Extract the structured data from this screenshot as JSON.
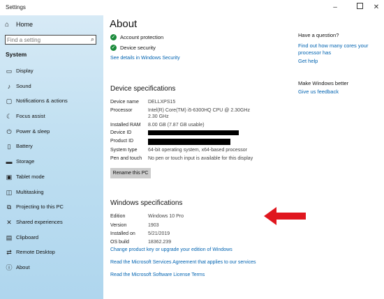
{
  "window": {
    "title": "Settings"
  },
  "sidebar": {
    "home_label": "Home",
    "search_placeholder": "Find a setting",
    "section_label": "System",
    "items": [
      {
        "label": "Display",
        "icon": "display-icon"
      },
      {
        "label": "Sound",
        "icon": "sound-icon"
      },
      {
        "label": "Notifications & actions",
        "icon": "notifications-icon"
      },
      {
        "label": "Focus assist",
        "icon": "focus-assist-icon"
      },
      {
        "label": "Power & sleep",
        "icon": "power-icon"
      },
      {
        "label": "Battery",
        "icon": "battery-icon"
      },
      {
        "label": "Storage",
        "icon": "storage-icon"
      },
      {
        "label": "Tablet mode",
        "icon": "tablet-icon"
      },
      {
        "label": "Multitasking",
        "icon": "multitasking-icon"
      },
      {
        "label": "Projecting to this PC",
        "icon": "projecting-icon"
      },
      {
        "label": "Shared experiences",
        "icon": "shared-icon"
      },
      {
        "label": "Clipboard",
        "icon": "clipboard-icon"
      },
      {
        "label": "Remote Desktop",
        "icon": "remote-desktop-icon"
      },
      {
        "label": "About",
        "icon": "info-icon"
      }
    ]
  },
  "main": {
    "title": "About",
    "security": {
      "items": [
        "Account protection",
        "Device security"
      ],
      "link": "See details in Windows Security"
    },
    "device_specs": {
      "heading": "Device specifications",
      "rows": [
        {
          "label": "Device name",
          "value": "DELLXPS15"
        },
        {
          "label": "Processor",
          "value": "Intel(R) Core(TM) i5-6300HQ CPU @ 2.30GHz",
          "value2": "2.30 GHz"
        },
        {
          "label": "Installed RAM",
          "value": "8.00 GB (7.87 GB usable)"
        },
        {
          "label": "Device ID",
          "value": ""
        },
        {
          "label": "Product ID",
          "value": ""
        },
        {
          "label": "System type",
          "value": "64-bit operating system, x64-based processor"
        },
        {
          "label": "Pen and touch",
          "value": "No pen or touch input is available for this display"
        }
      ],
      "rename_button": "Rename this PC"
    },
    "windows_specs": {
      "heading": "Windows specifications",
      "rows": [
        {
          "label": "Edition",
          "value": "Windows 10 Pro"
        },
        {
          "label": "Version",
          "value": "1903"
        },
        {
          "label": "Installed on",
          "value": "5/21/2019"
        },
        {
          "label": "OS build",
          "value": "18362.239"
        }
      ],
      "links": [
        "Change product key or upgrade your edition of Windows",
        "Read the Microsoft Services Agreement that applies to our services",
        "Read the Microsoft Software License Terms"
      ]
    }
  },
  "right": {
    "question_heading": "Have a question?",
    "question_link": "Find out how many cores your processor has",
    "help_link": "Get help",
    "better_heading": "Make Windows better",
    "feedback_link": "Give us feedback"
  },
  "colors": {
    "accent": "#0063b1",
    "check": "#1a8a3a",
    "arrow": "#e0161e",
    "button": "#cccccc"
  }
}
